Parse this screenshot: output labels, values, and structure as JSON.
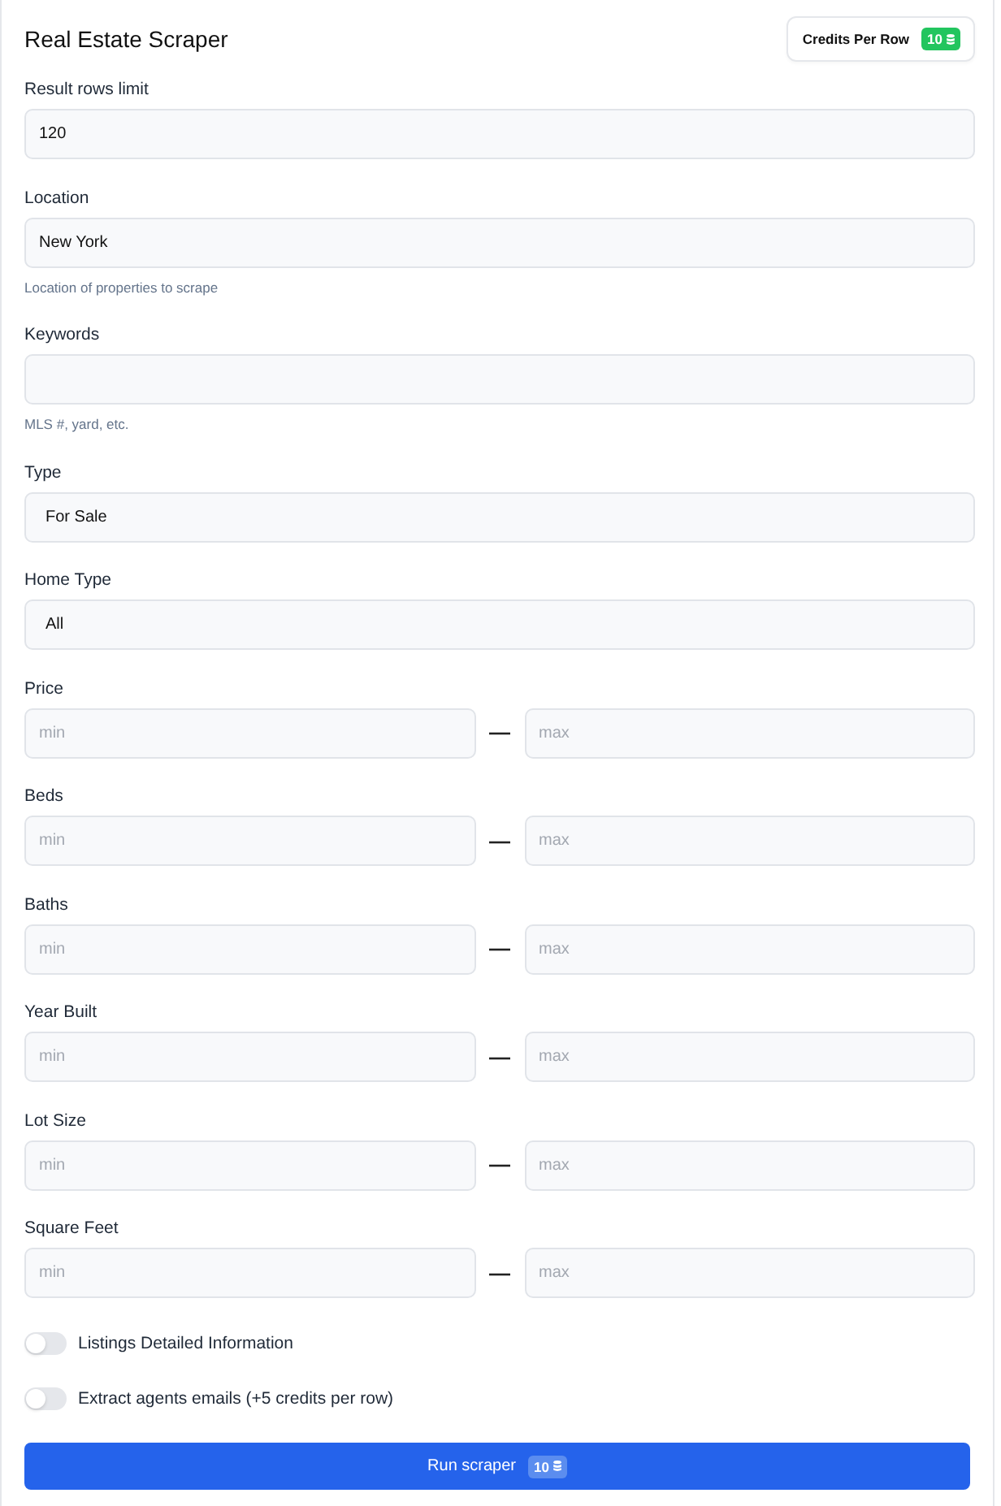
{
  "header": {
    "title": "Real Estate Scraper",
    "credits": {
      "label": "Credits Per Row",
      "value": "10"
    }
  },
  "fields": [
    {
      "kind": "text",
      "label": "Result rows limit",
      "value": "120"
    },
    {
      "kind": "text",
      "label": "Location",
      "value": "New York",
      "hint": "Location of properties to scrape"
    },
    {
      "kind": "text",
      "label": "Keywords",
      "hint": "MLS #, yard, etc."
    },
    {
      "kind": "select",
      "label": "Type",
      "value": "For Sale"
    },
    {
      "kind": "select",
      "label": "Home Type",
      "value": "All"
    },
    {
      "kind": "range",
      "label": "Price",
      "min": {
        "placeholder": "min"
      },
      "separator": "—",
      "max": {
        "placeholder": "max"
      }
    },
    {
      "kind": "range",
      "label": "Beds",
      "min": {
        "placeholder": "min"
      },
      "separator": "—",
      "max": {
        "placeholder": "max"
      }
    },
    {
      "kind": "range",
      "label": "Baths",
      "min": {
        "placeholder": "min"
      },
      "separator": "—",
      "max": {
        "placeholder": "max"
      }
    },
    {
      "kind": "range",
      "label": "Year Built",
      "min": {
        "placeholder": "min"
      },
      "separator": "—",
      "max": {
        "placeholder": "max"
      }
    },
    {
      "kind": "range",
      "label": "Lot Size",
      "min": {
        "placeholder": "min"
      },
      "separator": "—",
      "max": {
        "placeholder": "max"
      }
    },
    {
      "kind": "range",
      "label": "Square Feet",
      "min": {
        "placeholder": "min"
      },
      "separator": "—",
      "max": {
        "placeholder": "max"
      }
    }
  ],
  "toggles": [
    {
      "label": "Listings Detailed Information",
      "on": false
    },
    {
      "label": "Extract agents emails (+5 credits per row)",
      "on": false
    }
  ],
  "run_button": {
    "label": "Run scraper",
    "credits": "10"
  }
}
